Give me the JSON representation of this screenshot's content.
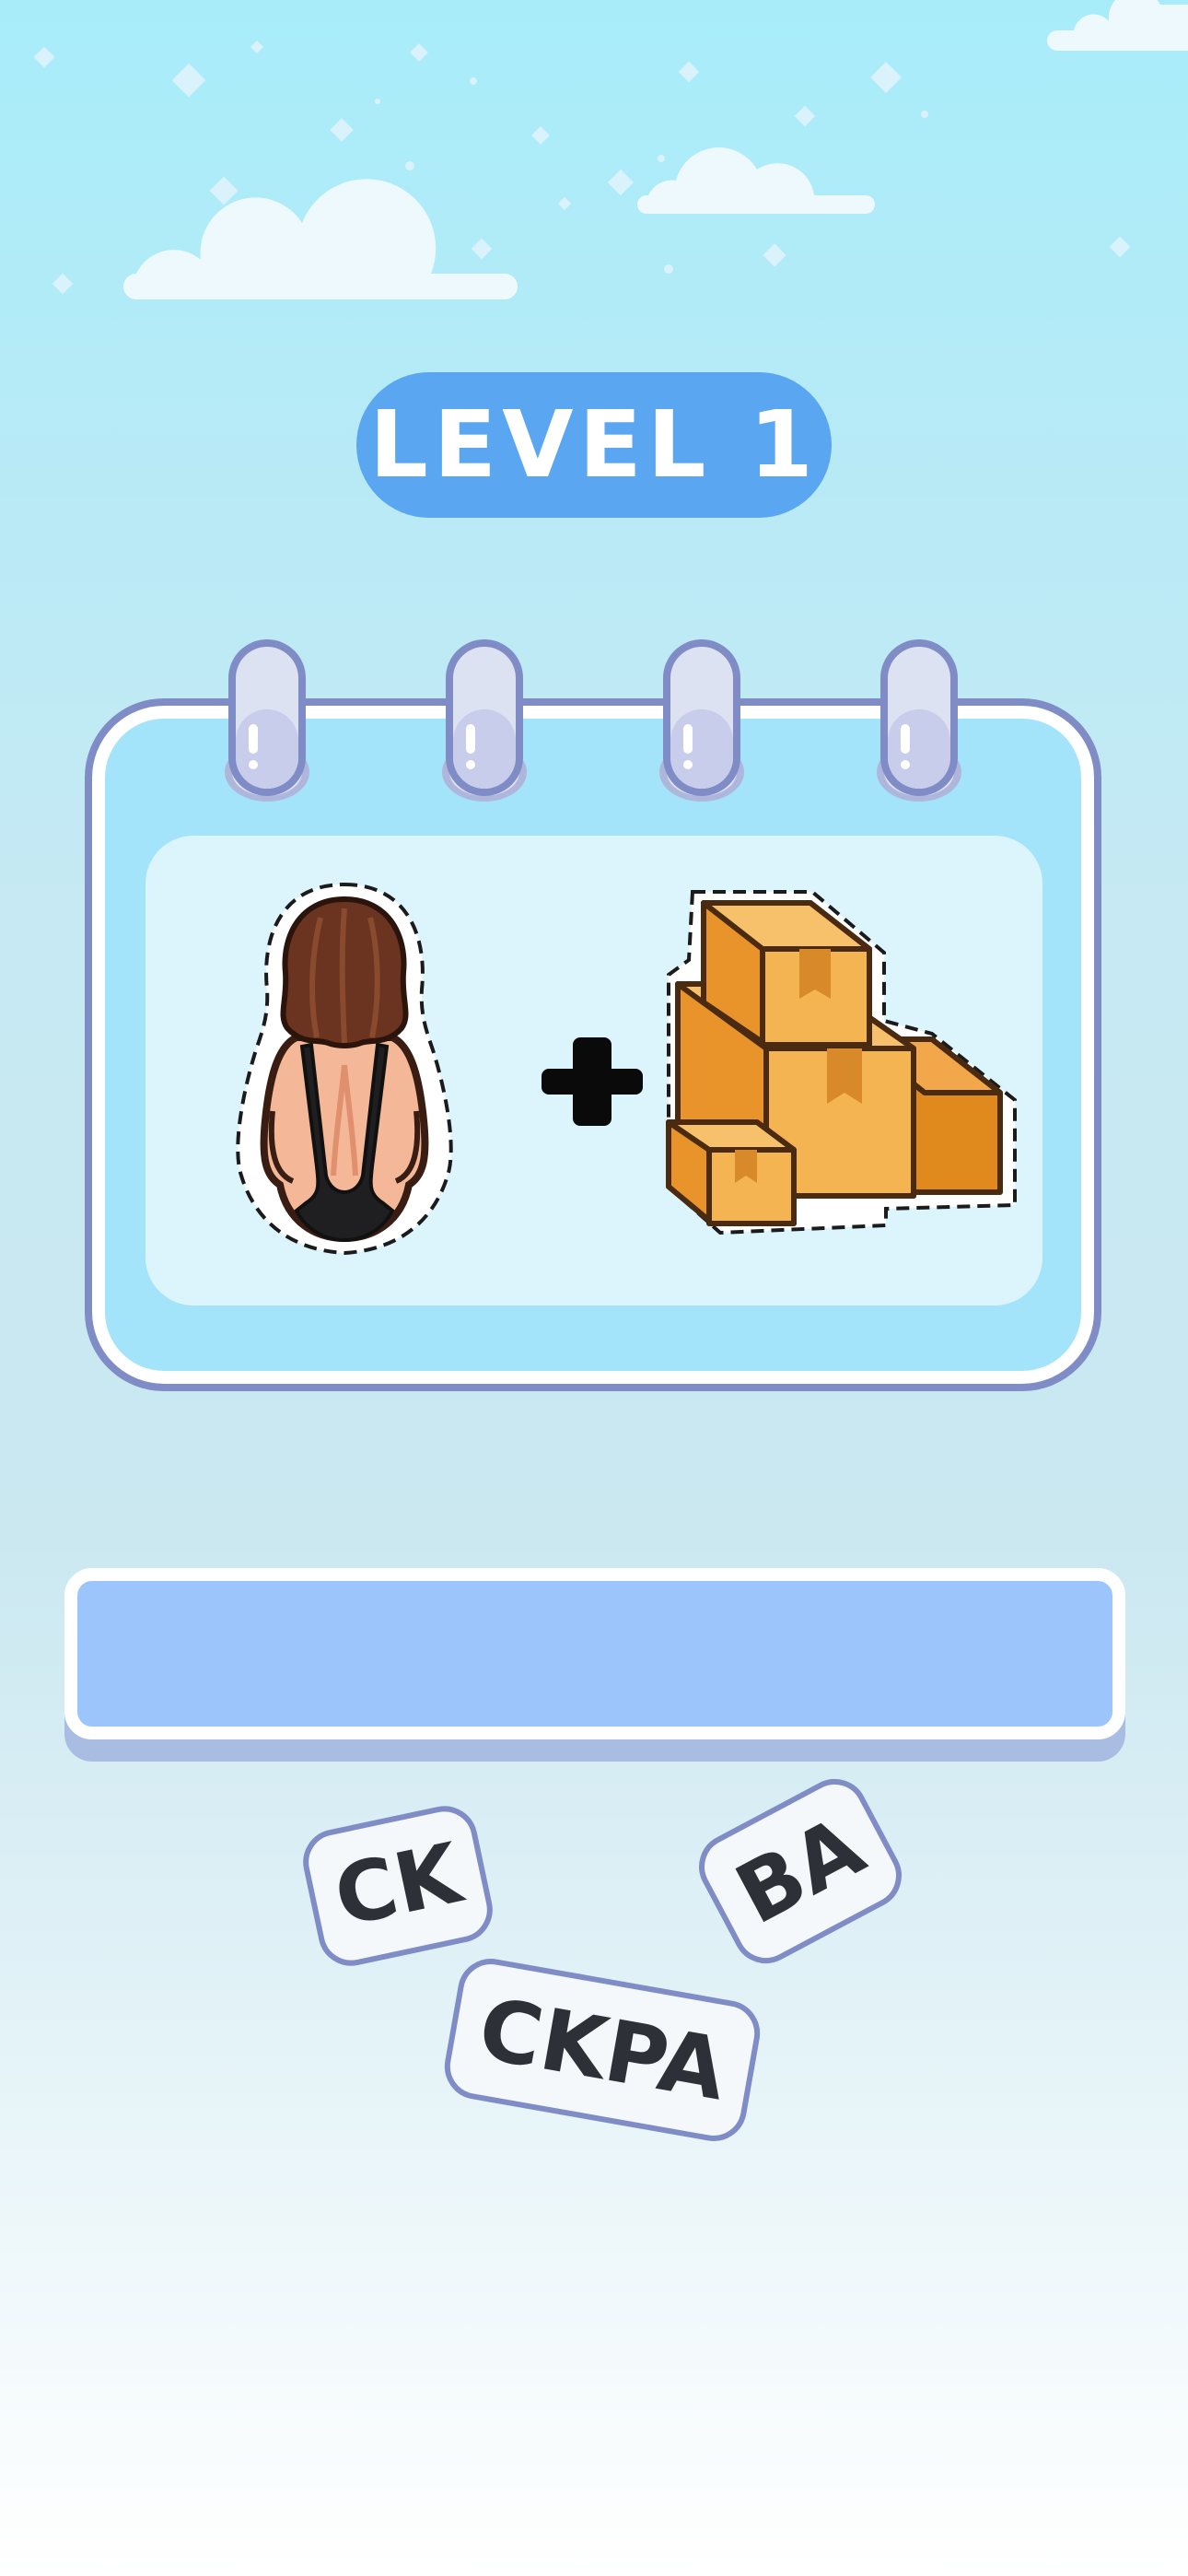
{
  "level": {
    "label": "LEVEL 1"
  },
  "puzzle": {
    "left_image": "woman-back-sticker",
    "operator": "+",
    "right_image": "cardboard-boxes-sticker"
  },
  "answer": {
    "value": ""
  },
  "tiles": [
    {
      "text": "CK"
    },
    {
      "text": "BA"
    },
    {
      "text": "CKPA"
    }
  ],
  "colors": {
    "pill": "#5aa6f0",
    "board": "#a4e4fa",
    "board_border": "#7f8cc6",
    "answer_bar": "#9bc5fb",
    "tile_text": "#2e3037"
  }
}
